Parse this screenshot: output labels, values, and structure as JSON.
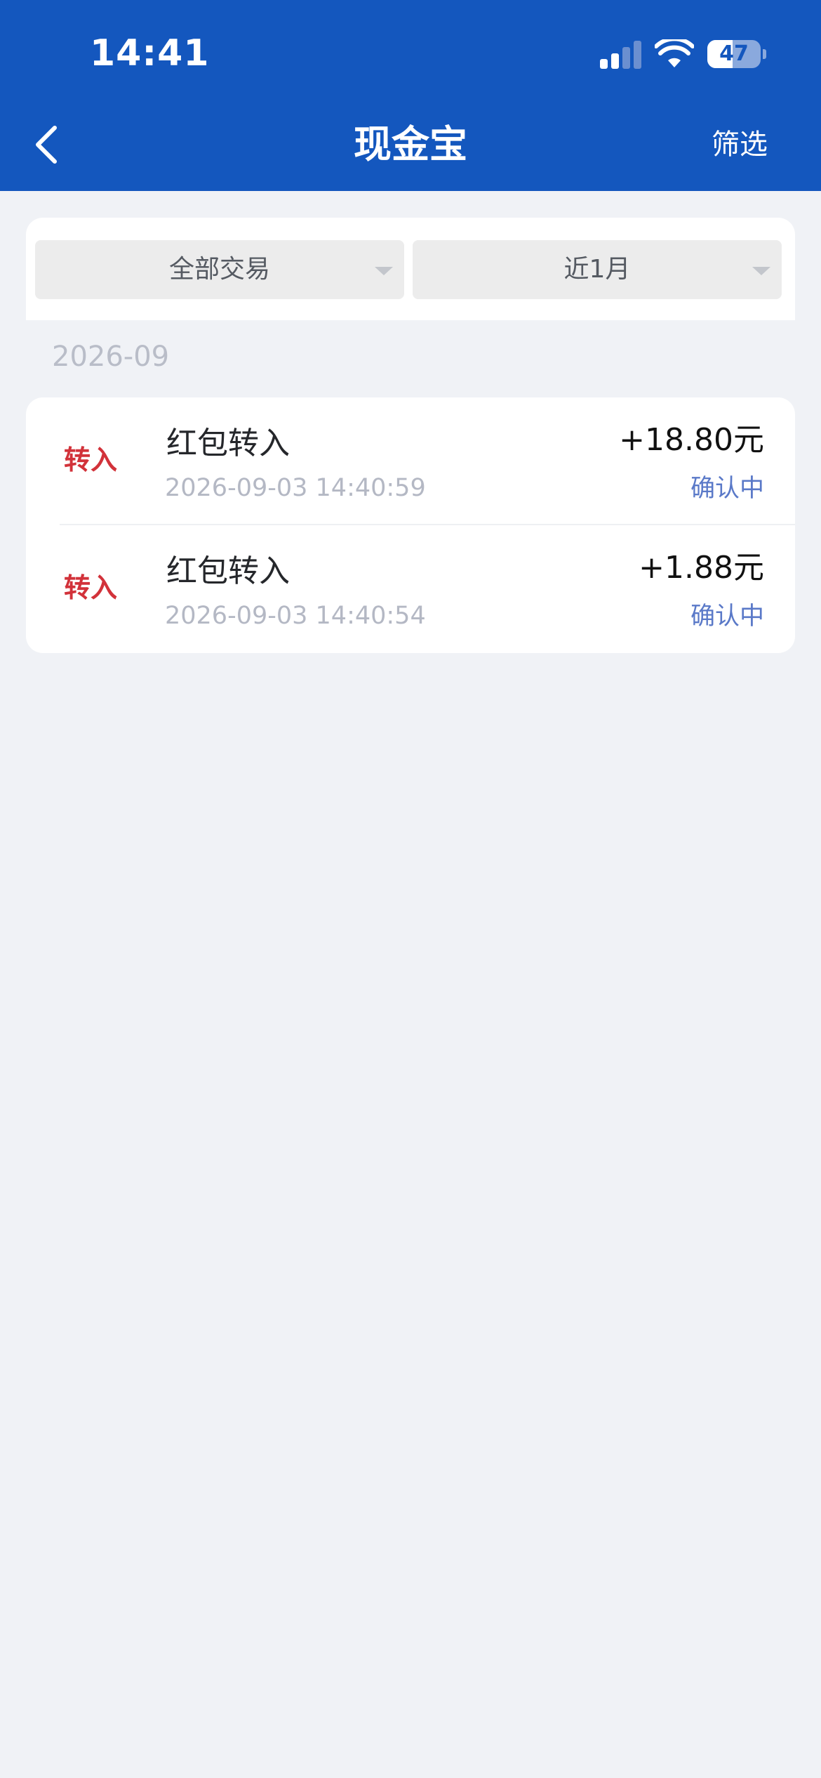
{
  "status_bar": {
    "time": "14:41",
    "battery_level": "47",
    "battery_fraction": 0.47
  },
  "nav": {
    "title": "现金宝",
    "filter_label": "筛选",
    "back_icon": "chevron-left-icon"
  },
  "filters": {
    "type_label": "全部交易",
    "period_label": "近1月"
  },
  "month": "2026-09",
  "transactions": [
    {
      "type": "转入",
      "title": "红包转入",
      "time": "2026-09-03 14:40:59",
      "amount": "+18.80元",
      "status": "确认中"
    },
    {
      "type": "转入",
      "title": "红包转入",
      "time": "2026-09-03 14:40:54",
      "amount": "+1.88元",
      "status": "确认中"
    }
  ],
  "colors": {
    "header_bg": "#1457be",
    "page_bg": "#f0f2f6",
    "type_red": "#d2323a",
    "status_blue": "#5a79c8"
  }
}
